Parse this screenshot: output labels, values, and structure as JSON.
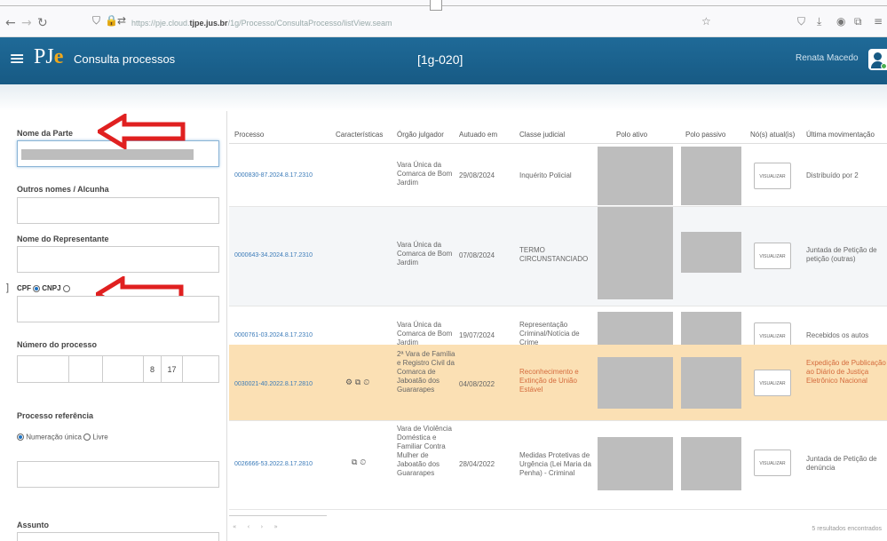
{
  "browser": {
    "back_icon": "back-arrow-icon",
    "forward_icon": "forward-arrow-icon",
    "reload_icon": "reload-icon",
    "url_prefix": "https://pje.cloud.",
    "url_host": "tjpe.jus.br",
    "url_path": "/1g/Processo/ConsultaProcesso/listView.seam"
  },
  "header": {
    "logo_p": "PJ",
    "logo_e": "e",
    "app_title": "Consulta processos",
    "org_title": "[1g-020]",
    "user_name": "Renata Macedo"
  },
  "filters": {
    "nome_parte_label": "Nome da Parte",
    "outros_nomes_label": "Outros nomes / Alcunha",
    "representante_label": "Nome do Representante",
    "cpf_label": "CPF",
    "cnpj_label": "CNPJ",
    "numero_processo_label": "Número do processo",
    "numero_segments": [
      "",
      "",
      "",
      "8",
      "17",
      ""
    ],
    "processo_ref_label": "Processo referência",
    "numeracao_unica_label": "Numeração única",
    "livre_label": "Livre",
    "assunto_label": "Assunto"
  },
  "table": {
    "columns": [
      "Processo",
      "Características",
      "Órgão julgador",
      "Autuado em",
      "Classe judicial",
      "Polo ativo",
      "Polo passivo",
      "Nó(s) atual(is)",
      "Última movimentação"
    ],
    "rows": [
      {
        "processo": "0000830-87.2024.8.17.2310",
        "orgao": "Vara Única da Comarca de Bom Jardim",
        "autuado": "29/08/2024",
        "classe": "Inquérito Policial",
        "button": "VISUALIZAR",
        "ultima": "Distribuído por 2",
        "chars": ""
      },
      {
        "processo": "0000643-34.2024.8.17.2310",
        "orgao": "Vara Única da Comarca de Bom Jardim",
        "autuado": "07/08/2024",
        "classe": "TERMO CIRCUNSTANCIADO",
        "button": "VISUALIZAR",
        "ultima": "Juntada de Petição de petição (outras)",
        "chars": ""
      },
      {
        "processo": "0000761-03.2024.8.17.2310",
        "orgao": "Vara Única da Comarca de Bom Jardim",
        "autuado": "19/07/2024",
        "classe": "Representação Criminal/Notícia de Crime",
        "button": "VISUALIZAR",
        "ultima": "Recebidos os autos",
        "chars": ""
      },
      {
        "processo": "0030021-40.2022.8.17.2810",
        "orgao": "2ª Vara de Família e Registro Civil da Comarca de Jaboatão dos Guararapes",
        "autuado": "04/08/2022",
        "classe": "Reconhecimento e Extinção de União Estável",
        "button": "VISUALIZAR",
        "ultima": "Expedição de Publicação ao Diário de Justiça Eletrônico Nacional",
        "chars": "⚙ ⧉ ⏲"
      },
      {
        "processo": "0026666-53.2022.8.17.2810",
        "orgao": "Vara de Violência Doméstica e Familiar Contra Mulher de Jaboatão dos Guararapes",
        "autuado": "28/04/2022",
        "classe": "Medidas Protetivas de Urgência (Lei Maria da Penha) - Criminal",
        "button": "VISUALIZAR",
        "ultima": "Juntada de Petição de denúncia",
        "chars": "⧉ ⏲"
      }
    ],
    "pager": "« ‹ › »",
    "results": "5 resultados encontrados"
  },
  "colors": {
    "header_blue": "#1c6390",
    "highlight_row": "#fbe0b4",
    "annotation_arrow": "#e02020",
    "link_blue": "#3a7ab8"
  }
}
